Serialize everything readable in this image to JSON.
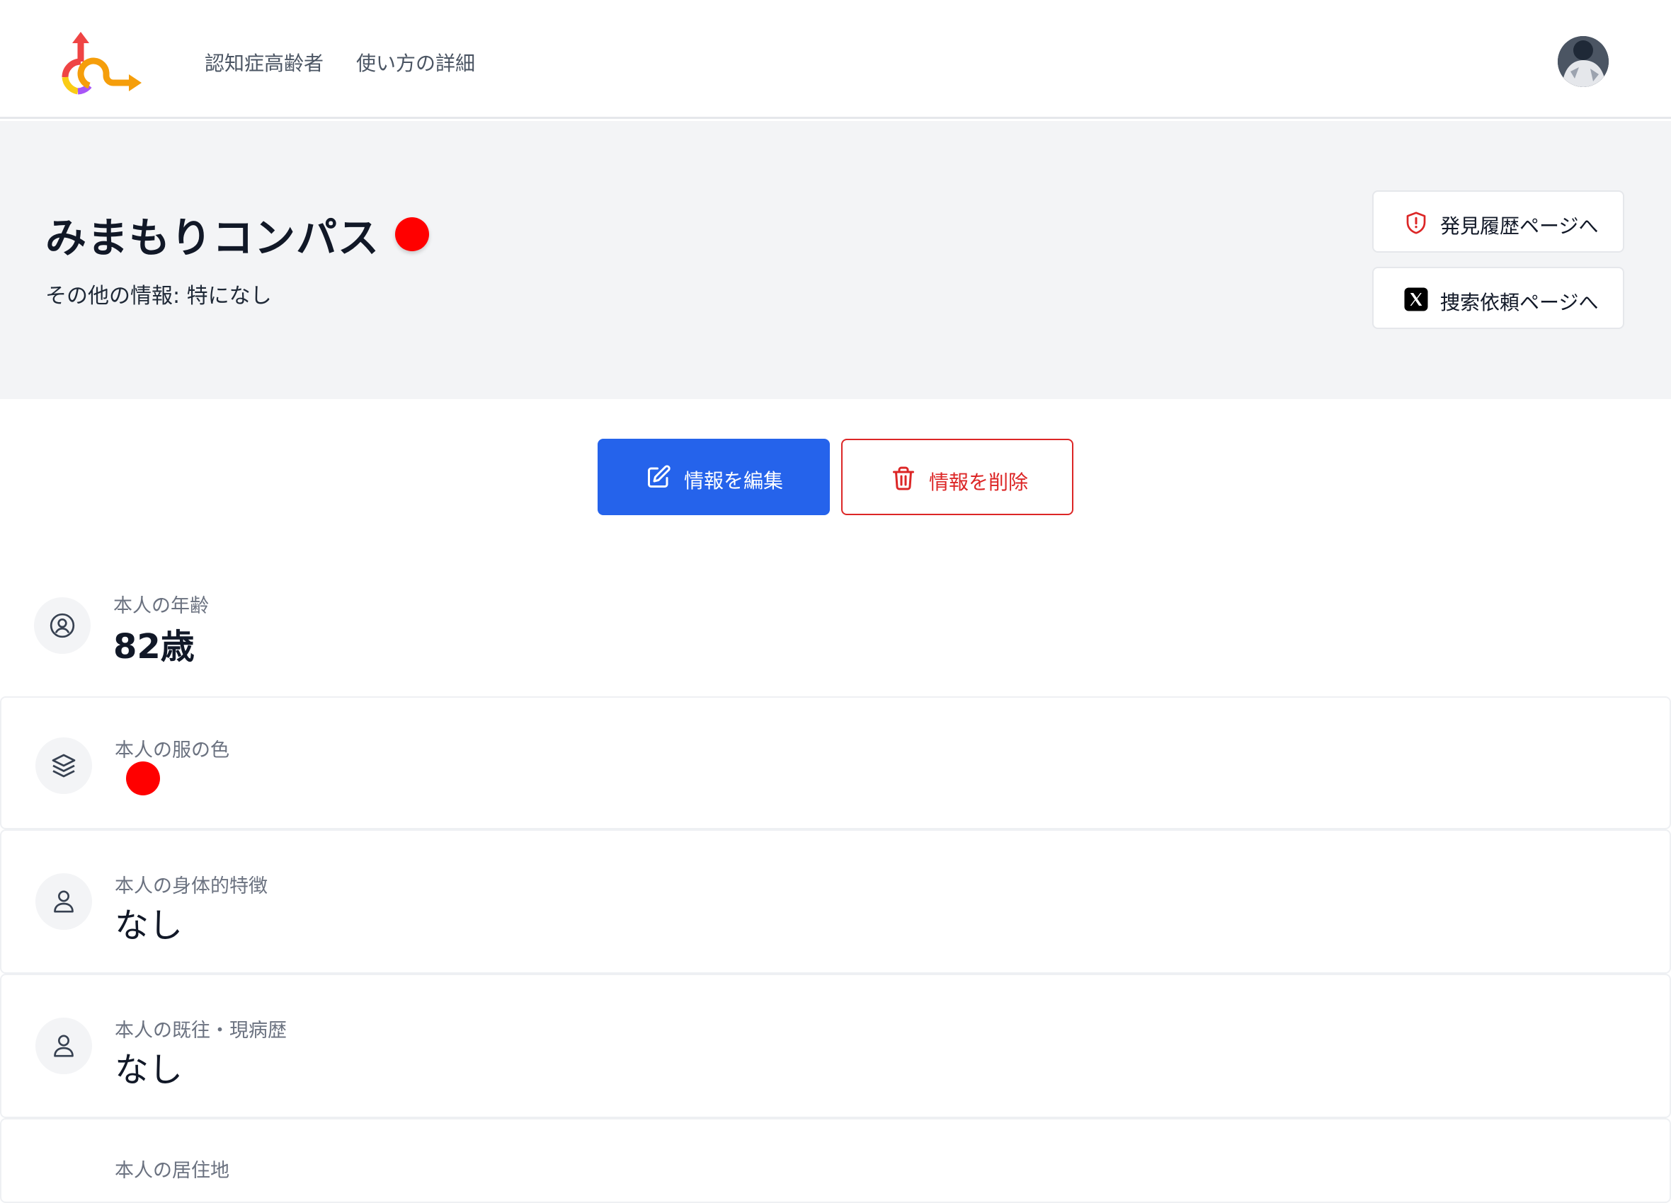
{
  "nav": {
    "links": [
      "認知症高齢者",
      "使い方の詳細"
    ]
  },
  "hero": {
    "title": "みまもりコンパス",
    "status_color": "#ff0000",
    "subtitle": "その他の情報: 特になし",
    "buttons": {
      "history": "発見履歴ページへ",
      "search": "捜索依頼ページへ"
    }
  },
  "actions": {
    "edit": "情報を編集",
    "delete": "情報を削除"
  },
  "info": {
    "age": {
      "label": "本人の年齢",
      "value": "82歳"
    },
    "clothes": {
      "label": "本人の服の色",
      "color": "#ff0000"
    },
    "physical": {
      "label": "本人の身体的特徴",
      "value": "なし"
    },
    "history": {
      "label": "本人の既往・現病歴",
      "value": "なし"
    },
    "next": {
      "label": "本人の居住地"
    }
  },
  "colors": {
    "primary": "#2563eb",
    "danger": "#dc2626",
    "hero_bg": "#f3f4f6"
  }
}
